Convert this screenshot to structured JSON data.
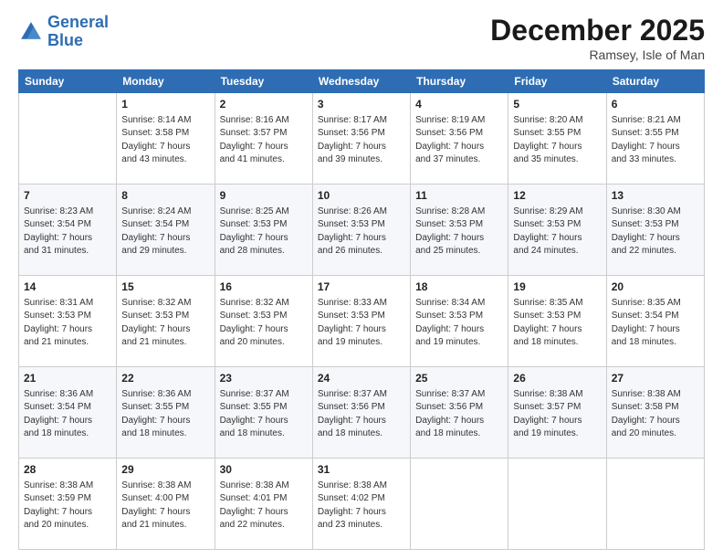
{
  "logo": {
    "line1": "General",
    "line2": "Blue"
  },
  "header": {
    "title": "December 2025",
    "location": "Ramsey, Isle of Man"
  },
  "days_of_week": [
    "Sunday",
    "Monday",
    "Tuesday",
    "Wednesday",
    "Thursday",
    "Friday",
    "Saturday"
  ],
  "weeks": [
    [
      {
        "day": "",
        "info": ""
      },
      {
        "day": "1",
        "info": "Sunrise: 8:14 AM\nSunset: 3:58 PM\nDaylight: 7 hours\nand 43 minutes."
      },
      {
        "day": "2",
        "info": "Sunrise: 8:16 AM\nSunset: 3:57 PM\nDaylight: 7 hours\nand 41 minutes."
      },
      {
        "day": "3",
        "info": "Sunrise: 8:17 AM\nSunset: 3:56 PM\nDaylight: 7 hours\nand 39 minutes."
      },
      {
        "day": "4",
        "info": "Sunrise: 8:19 AM\nSunset: 3:56 PM\nDaylight: 7 hours\nand 37 minutes."
      },
      {
        "day": "5",
        "info": "Sunrise: 8:20 AM\nSunset: 3:55 PM\nDaylight: 7 hours\nand 35 minutes."
      },
      {
        "day": "6",
        "info": "Sunrise: 8:21 AM\nSunset: 3:55 PM\nDaylight: 7 hours\nand 33 minutes."
      }
    ],
    [
      {
        "day": "7",
        "info": "Sunrise: 8:23 AM\nSunset: 3:54 PM\nDaylight: 7 hours\nand 31 minutes."
      },
      {
        "day": "8",
        "info": "Sunrise: 8:24 AM\nSunset: 3:54 PM\nDaylight: 7 hours\nand 29 minutes."
      },
      {
        "day": "9",
        "info": "Sunrise: 8:25 AM\nSunset: 3:53 PM\nDaylight: 7 hours\nand 28 minutes."
      },
      {
        "day": "10",
        "info": "Sunrise: 8:26 AM\nSunset: 3:53 PM\nDaylight: 7 hours\nand 26 minutes."
      },
      {
        "day": "11",
        "info": "Sunrise: 8:28 AM\nSunset: 3:53 PM\nDaylight: 7 hours\nand 25 minutes."
      },
      {
        "day": "12",
        "info": "Sunrise: 8:29 AM\nSunset: 3:53 PM\nDaylight: 7 hours\nand 24 minutes."
      },
      {
        "day": "13",
        "info": "Sunrise: 8:30 AM\nSunset: 3:53 PM\nDaylight: 7 hours\nand 22 minutes."
      }
    ],
    [
      {
        "day": "14",
        "info": "Sunrise: 8:31 AM\nSunset: 3:53 PM\nDaylight: 7 hours\nand 21 minutes."
      },
      {
        "day": "15",
        "info": "Sunrise: 8:32 AM\nSunset: 3:53 PM\nDaylight: 7 hours\nand 21 minutes."
      },
      {
        "day": "16",
        "info": "Sunrise: 8:32 AM\nSunset: 3:53 PM\nDaylight: 7 hours\nand 20 minutes."
      },
      {
        "day": "17",
        "info": "Sunrise: 8:33 AM\nSunset: 3:53 PM\nDaylight: 7 hours\nand 19 minutes."
      },
      {
        "day": "18",
        "info": "Sunrise: 8:34 AM\nSunset: 3:53 PM\nDaylight: 7 hours\nand 19 minutes."
      },
      {
        "day": "19",
        "info": "Sunrise: 8:35 AM\nSunset: 3:53 PM\nDaylight: 7 hours\nand 18 minutes."
      },
      {
        "day": "20",
        "info": "Sunrise: 8:35 AM\nSunset: 3:54 PM\nDaylight: 7 hours\nand 18 minutes."
      }
    ],
    [
      {
        "day": "21",
        "info": "Sunrise: 8:36 AM\nSunset: 3:54 PM\nDaylight: 7 hours\nand 18 minutes."
      },
      {
        "day": "22",
        "info": "Sunrise: 8:36 AM\nSunset: 3:55 PM\nDaylight: 7 hours\nand 18 minutes."
      },
      {
        "day": "23",
        "info": "Sunrise: 8:37 AM\nSunset: 3:55 PM\nDaylight: 7 hours\nand 18 minutes."
      },
      {
        "day": "24",
        "info": "Sunrise: 8:37 AM\nSunset: 3:56 PM\nDaylight: 7 hours\nand 18 minutes."
      },
      {
        "day": "25",
        "info": "Sunrise: 8:37 AM\nSunset: 3:56 PM\nDaylight: 7 hours\nand 18 minutes."
      },
      {
        "day": "26",
        "info": "Sunrise: 8:38 AM\nSunset: 3:57 PM\nDaylight: 7 hours\nand 19 minutes."
      },
      {
        "day": "27",
        "info": "Sunrise: 8:38 AM\nSunset: 3:58 PM\nDaylight: 7 hours\nand 20 minutes."
      }
    ],
    [
      {
        "day": "28",
        "info": "Sunrise: 8:38 AM\nSunset: 3:59 PM\nDaylight: 7 hours\nand 20 minutes."
      },
      {
        "day": "29",
        "info": "Sunrise: 8:38 AM\nSunset: 4:00 PM\nDaylight: 7 hours\nand 21 minutes."
      },
      {
        "day": "30",
        "info": "Sunrise: 8:38 AM\nSunset: 4:01 PM\nDaylight: 7 hours\nand 22 minutes."
      },
      {
        "day": "31",
        "info": "Sunrise: 8:38 AM\nSunset: 4:02 PM\nDaylight: 7 hours\nand 23 minutes."
      },
      {
        "day": "",
        "info": ""
      },
      {
        "day": "",
        "info": ""
      },
      {
        "day": "",
        "info": ""
      }
    ]
  ]
}
